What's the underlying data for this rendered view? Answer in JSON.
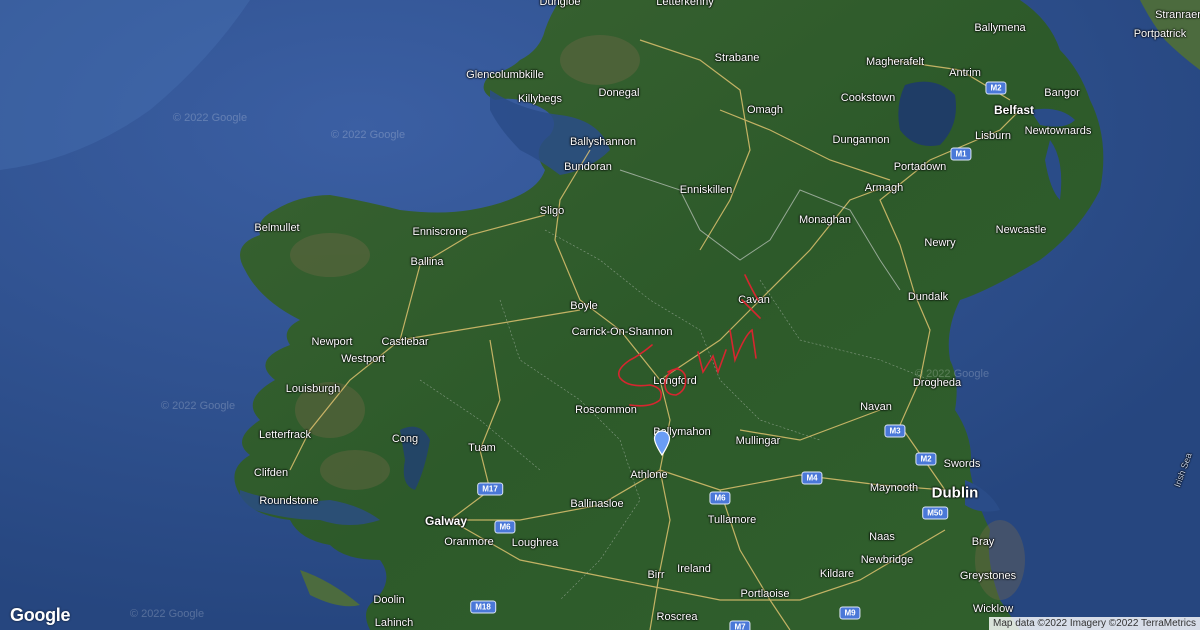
{
  "map": {
    "colors": {
      "sea": "#2d4f8e",
      "land": "#2f5a2c",
      "road": "#e8c873",
      "scribble": "#d6262f",
      "pin": "#6a9df5"
    },
    "cities": [
      {
        "id": "dungloe",
        "name": "Dungloe"
      },
      {
        "id": "letterkenny",
        "name": "Letterkenny"
      },
      {
        "id": "ballymena",
        "name": "Ballymena"
      },
      {
        "id": "portstewart",
        "name": "Portpatrick"
      },
      {
        "id": "stranraer",
        "name": "Stranraer"
      },
      {
        "id": "glencolumbkille",
        "name": "Glencolumbkille"
      },
      {
        "id": "strabane",
        "name": "Strabane"
      },
      {
        "id": "magherafelt",
        "name": "Magherafelt"
      },
      {
        "id": "antrim",
        "name": "Antrim"
      },
      {
        "id": "killybegs",
        "name": "Killybegs"
      },
      {
        "id": "donegal",
        "name": "Donegal"
      },
      {
        "id": "omagh",
        "name": "Omagh"
      },
      {
        "id": "cookstown",
        "name": "Cookstown"
      },
      {
        "id": "bangor",
        "name": "Bangor"
      },
      {
        "id": "belfast",
        "name": "Belfast"
      },
      {
        "id": "lisburn",
        "name": "Lisburn"
      },
      {
        "id": "newtownards",
        "name": "Newtownards"
      },
      {
        "id": "ballyshannon",
        "name": "Ballyshannon"
      },
      {
        "id": "dungannon",
        "name": "Dungannon"
      },
      {
        "id": "bundoran",
        "name": "Bundoran"
      },
      {
        "id": "portadown",
        "name": "Portadown"
      },
      {
        "id": "enniskillen",
        "name": "Enniskillen"
      },
      {
        "id": "armagh",
        "name": "Armagh"
      },
      {
        "id": "sligo",
        "name": "Sligo"
      },
      {
        "id": "monaghan",
        "name": "Monaghan"
      },
      {
        "id": "belmullet",
        "name": "Belmullet"
      },
      {
        "id": "enniscrone",
        "name": "Enniscrone"
      },
      {
        "id": "newcastle",
        "name": "Newcastle"
      },
      {
        "id": "newry",
        "name": "Newry"
      },
      {
        "id": "ballina",
        "name": "Ballina"
      },
      {
        "id": "dundalk",
        "name": "Dundalk"
      },
      {
        "id": "boyle",
        "name": "Boyle"
      },
      {
        "id": "cavan",
        "name": "Cavan"
      },
      {
        "id": "carrick",
        "name": "Carrick-On-Shannon"
      },
      {
        "id": "newport",
        "name": "Newport"
      },
      {
        "id": "castlebar",
        "name": "Castlebar"
      },
      {
        "id": "westport",
        "name": "Westport"
      },
      {
        "id": "longford",
        "name": "Longford"
      },
      {
        "id": "louisburgh",
        "name": "Louisburgh"
      },
      {
        "id": "drogheda",
        "name": "Drogheda"
      },
      {
        "id": "roscommon",
        "name": "Roscommon"
      },
      {
        "id": "navan",
        "name": "Navan"
      },
      {
        "id": "letterfrack",
        "name": "Letterfrack"
      },
      {
        "id": "ballymahon",
        "name": "Ballymahon"
      },
      {
        "id": "cong",
        "name": "Cong"
      },
      {
        "id": "mullingar",
        "name": "Mullingar"
      },
      {
        "id": "tuam",
        "name": "Tuam"
      },
      {
        "id": "swords",
        "name": "Swords"
      },
      {
        "id": "clifden",
        "name": "Clifden"
      },
      {
        "id": "athlone",
        "name": "Athlone"
      },
      {
        "id": "maynooth",
        "name": "Maynooth"
      },
      {
        "id": "roundstone",
        "name": "Roundstone"
      },
      {
        "id": "ballinasloe",
        "name": "Ballinasloe"
      },
      {
        "id": "tullamore",
        "name": "Tullamore"
      },
      {
        "id": "galway",
        "name": "Galway"
      },
      {
        "id": "dublin",
        "name": "Dublin"
      },
      {
        "id": "oranmore",
        "name": "Oranmore"
      },
      {
        "id": "loughrea",
        "name": "Loughrea"
      },
      {
        "id": "naas",
        "name": "Naas"
      },
      {
        "id": "bray",
        "name": "Bray"
      },
      {
        "id": "newbridge",
        "name": "Newbridge"
      },
      {
        "id": "birr",
        "name": "Birr"
      },
      {
        "id": "ireland",
        "name": "Ireland"
      },
      {
        "id": "kildare",
        "name": "Kildare"
      },
      {
        "id": "greystones",
        "name": "Greystones"
      },
      {
        "id": "doolin",
        "name": "Doolin"
      },
      {
        "id": "portlaoise",
        "name": "Portlaoise"
      },
      {
        "id": "lahinch",
        "name": "Lahinch"
      },
      {
        "id": "roscrea",
        "name": "Roscrea"
      },
      {
        "id": "wicklow",
        "name": "Wicklow"
      }
    ],
    "sea_label": "Irish Sea",
    "watermark": "© 2022 Google",
    "shields": [
      "M2",
      "M1",
      "M3",
      "M2",
      "M4",
      "M50",
      "M17",
      "M6",
      "M6",
      "M18",
      "M9",
      "M7"
    ],
    "scribble_text": "Sown"
  },
  "logo": "Google",
  "attribution": "Map data ©2022 Imagery ©2022 TerraMetrics"
}
